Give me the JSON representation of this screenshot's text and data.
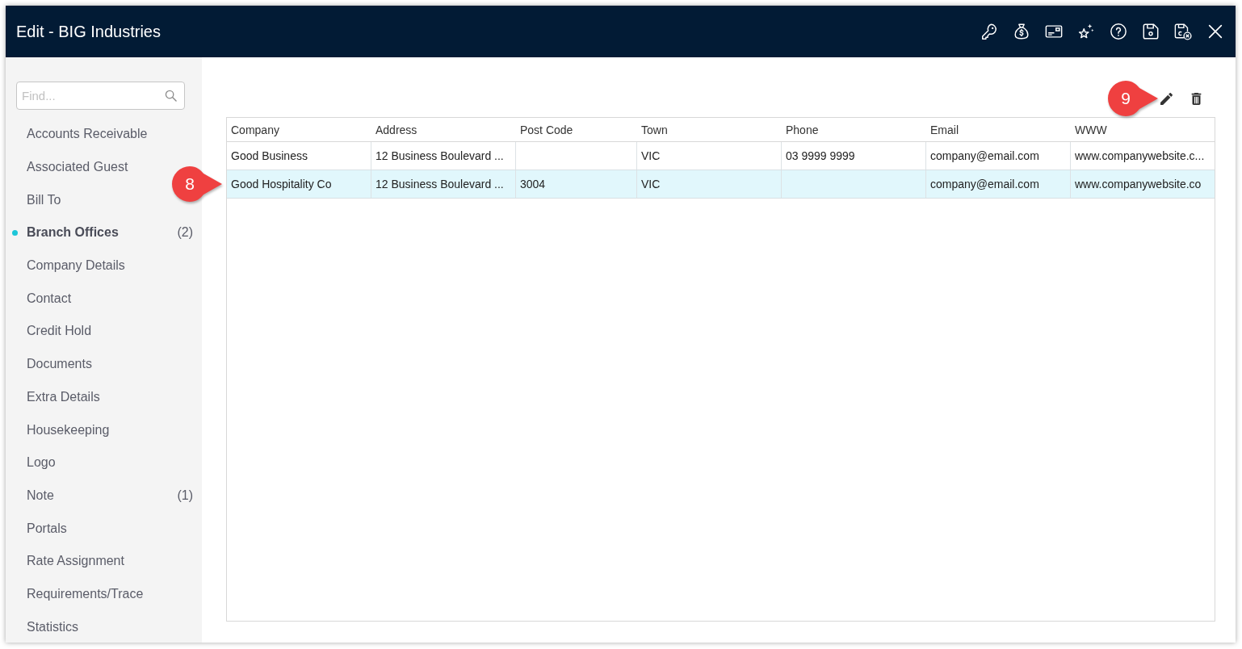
{
  "window": {
    "title": "Edit - BIG Industries"
  },
  "sidebar": {
    "search": {
      "placeholder": "Find..."
    },
    "items": [
      {
        "label": "Accounts Receivable",
        "selected": false
      },
      {
        "label": "Associated Guest",
        "selected": false
      },
      {
        "label": "Bill To",
        "selected": false
      },
      {
        "label": "Branch Offices",
        "count": "(2)",
        "selected": true
      },
      {
        "label": "Company Details",
        "selected": false
      },
      {
        "label": "Contact",
        "selected": false
      },
      {
        "label": "Credit Hold",
        "selected": false
      },
      {
        "label": "Documents",
        "selected": false
      },
      {
        "label": "Extra Details",
        "selected": false
      },
      {
        "label": "Housekeeping",
        "selected": false
      },
      {
        "label": "Logo",
        "selected": false
      },
      {
        "label": "Note",
        "count": "(1)",
        "selected": false
      },
      {
        "label": "Portals",
        "selected": false
      },
      {
        "label": "Rate Assignment",
        "selected": false
      },
      {
        "label": "Requirements/Trace",
        "selected": false
      },
      {
        "label": "Statistics",
        "selected": false
      }
    ]
  },
  "toolbar": {
    "buttons": [
      {
        "kind": "edit",
        "callout": "9"
      },
      {
        "kind": "delete"
      }
    ]
  },
  "table": {
    "columns": [
      "Company",
      "Address",
      "Post Code",
      "Town",
      "Phone",
      "Email",
      "WWW"
    ],
    "rows": [
      {
        "company": "Good Business",
        "address": "12 Business Boulevard ...",
        "town": "VIC",
        "phone": "03 9999 9999",
        "email": "company@email.com",
        "www": "www.companywebsite.c...",
        "selected": false
      },
      {
        "company": "Good Hospitality Co",
        "address": "12 Business Boulevard ...",
        "post_code": "3004",
        "town": "VIC",
        "email": "company@email.com",
        "www": "www.companywebsite.co",
        "selected": true,
        "callout": "8"
      }
    ]
  }
}
